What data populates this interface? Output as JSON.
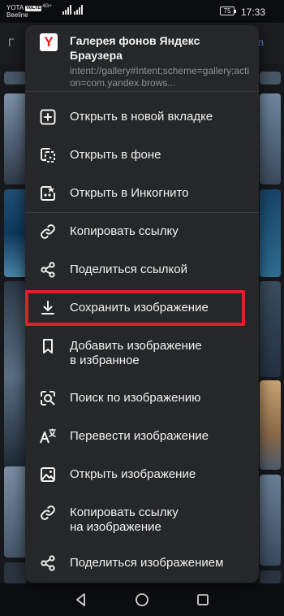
{
  "status_bar": {
    "carrier_1": "YOTA",
    "volte": "VoLTE",
    "network": "4G+",
    "carrier_2": "Beeline",
    "battery": "75",
    "time": "17:33"
  },
  "background": {
    "title": "Г",
    "accent_text": "а"
  },
  "menu": {
    "app_title": "Галерея фонов Яндекс Браузера",
    "url": "intent://gallery#Intent;scheme=gallery;action=com.yandex.brows...",
    "logo_letter": "Y",
    "items": [
      {
        "label": "Открыть в новой вкладке",
        "icon": "new-tab-icon"
      },
      {
        "label": "Открыть в фоне",
        "icon": "background-tab-icon"
      },
      {
        "label": "Открыть в Инкогнито",
        "icon": "incognito-icon"
      },
      {
        "label": "Копировать ссылку",
        "icon": "link-icon"
      },
      {
        "label": "Поделиться ссылкой",
        "icon": "share-icon"
      },
      {
        "label": "Сохранить изображение",
        "icon": "download-icon"
      },
      {
        "label": "Добавить изображение\nв избранное",
        "icon": "bookmark-icon"
      },
      {
        "label": "Поиск по изображению",
        "icon": "image-search-icon"
      },
      {
        "label": "Перевести изображение",
        "icon": "translate-icon"
      },
      {
        "label": "Открыть изображение",
        "icon": "image-icon"
      },
      {
        "label": "Копировать ссылку\nна изображение",
        "icon": "link-icon"
      },
      {
        "label": "Поделиться изображением",
        "icon": "share-icon"
      }
    ]
  },
  "colors": {
    "menu_bg": "#262729",
    "highlight": "#e0202a",
    "logo_red": "#f01b1b"
  }
}
